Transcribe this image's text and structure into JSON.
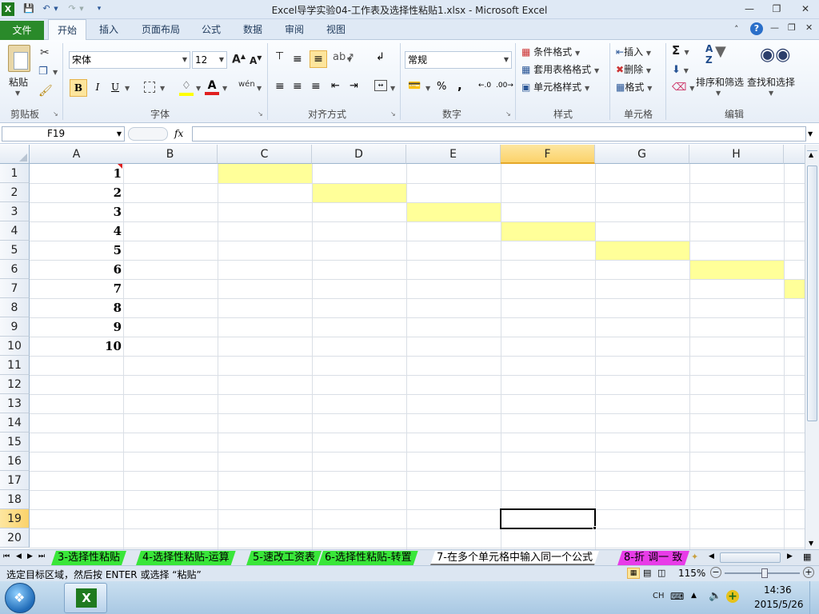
{
  "window": {
    "title": "Excel导学实验04-工作表及选择性粘贴1.xlsx  -  Microsoft Excel"
  },
  "ribbon_tabs": [
    "文件",
    "开始",
    "插入",
    "页面布局",
    "公式",
    "数据",
    "审阅",
    "视图"
  ],
  "ribbon": {
    "clipboard": {
      "paste_label": "粘贴",
      "group_label": "剪贴板"
    },
    "font": {
      "font_name": "宋体",
      "font_size": "12",
      "group_label": "字体",
      "bold": "B",
      "italic": "I",
      "underline": "U",
      "grow": "A",
      "shrink": "A",
      "font_color_glyph": "A",
      "wen": "wén"
    },
    "alignment": {
      "group_label": "对齐方式"
    },
    "number": {
      "format": "常规",
      "group_label": "数字",
      "percent": "%",
      "comma": ","
    },
    "styles": {
      "conditional": "条件格式",
      "table": "套用表格格式",
      "cell_styles": "单元格样式",
      "group_label": "样式"
    },
    "cells": {
      "insert": "插入",
      "delete": "删除",
      "format": "格式",
      "group_label": "单元格"
    },
    "editing": {
      "sigma": "Σ",
      "sort_filter": "排序和筛选",
      "find_select": "查找和选择",
      "group_label": "编辑"
    }
  },
  "formula_bar": {
    "name_box": "F19",
    "fx": "fx",
    "formula": ""
  },
  "grid": {
    "columns": [
      "A",
      "B",
      "C",
      "D",
      "E",
      "F",
      "G",
      "H"
    ],
    "selected_column": "F",
    "rows": [
      "1",
      "2",
      "3",
      "4",
      "5",
      "6",
      "7",
      "8",
      "9",
      "10",
      "11",
      "12",
      "13",
      "14",
      "15",
      "16",
      "17",
      "18",
      "19",
      "20"
    ],
    "selected_row": "19",
    "column_a_values": [
      "1",
      "2",
      "3",
      "4",
      "5",
      "6",
      "7",
      "8",
      "9",
      "10"
    ],
    "highlight_color": "#ffff99"
  },
  "sheet_tabs": [
    {
      "label": "3-选择性粘贴",
      "color": "#39e639"
    },
    {
      "label": "4-选择性粘贴-运算",
      "color": "#39e639"
    },
    {
      "label": "5-速改工资表",
      "color": "#39e639"
    },
    {
      "label": "6-选择性粘贴-转置",
      "color": "#39e639"
    },
    {
      "label": "7-在多个单元格中输入同一个公式",
      "color": "#ffffff"
    },
    {
      "label": "8-折 调一 致",
      "color": "#e83ce8"
    }
  ],
  "status": {
    "message": "选定目标区域，然后按 ENTER 或选择 “粘贴”",
    "zoom": "115%"
  },
  "taskbar": {
    "ime": "CH",
    "time": "14:36",
    "date": "2015/5/26"
  }
}
